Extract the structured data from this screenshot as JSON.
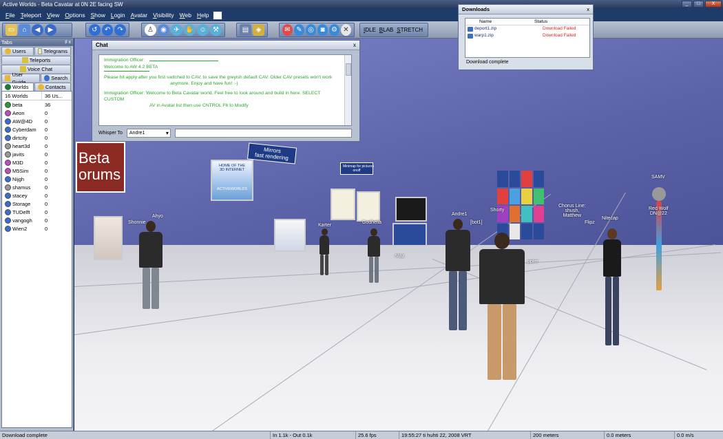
{
  "window": {
    "title": "Active Worlds - Beta Cavatar at 0N 2E facing SW",
    "min": "_",
    "max": "□",
    "close": "X"
  },
  "menu": [
    "File",
    "Teleport",
    "View",
    "Options",
    "Show",
    "Login",
    "Avatar",
    "Visibility",
    "Web",
    "Help"
  ],
  "toolbar": {
    "gestures": [
      "IDLE",
      "BLAB",
      "STRETCH"
    ]
  },
  "tabs_panel": {
    "title": "Tabs",
    "pin": "♯ x",
    "tabs": [
      "Users",
      "Telegrams",
      "Teleports",
      "Voice Chat",
      "User Guide",
      "Search",
      "Worlds",
      "Contacts"
    ],
    "worlds_header": {
      "count": "16 Worlds",
      "users": "36 Us..."
    },
    "worlds": [
      {
        "name": "beta",
        "users": "36",
        "color": "#2a9b3a"
      },
      {
        "name": "Aeon",
        "users": "0",
        "color": "#c04bc0"
      },
      {
        "name": "AW@4D",
        "users": "0",
        "color": "#3a6fd0"
      },
      {
        "name": "Cyberdam",
        "users": "0",
        "color": "#3a6fd0"
      },
      {
        "name": "dirtcity",
        "users": "0",
        "color": "#3a6fd0"
      },
      {
        "name": "heart3d",
        "users": "0",
        "color": "#9a9a9a"
      },
      {
        "name": "javits",
        "users": "0",
        "color": "#9a9a9a"
      },
      {
        "name": "M3D",
        "users": "0",
        "color": "#c04bc0"
      },
      {
        "name": "M5Sim",
        "users": "0",
        "color": "#c04bc0"
      },
      {
        "name": "Nijgh",
        "users": "0",
        "color": "#3a6fd0"
      },
      {
        "name": "shamus",
        "users": "0",
        "color": "#9a9a9a"
      },
      {
        "name": "stacey",
        "users": "0",
        "color": "#3a6fd0"
      },
      {
        "name": "Storage",
        "users": "0",
        "color": "#3a6fd0"
      },
      {
        "name": "TUDelft",
        "users": "0",
        "color": "#3a6fd0"
      },
      {
        "name": "vangogh",
        "users": "0",
        "color": "#3a6fd0"
      },
      {
        "name": "Wien2",
        "users": "0",
        "color": "#3a6fd0"
      }
    ]
  },
  "chat": {
    "title": "Chat",
    "close": "x",
    "lines": [
      "Immigration Officer:",
      "Welcome to AW 4.2 BETA",
      "Please hit apply after you first switched to CAV, to save the greyish default CAV. Older CAV presets won't work",
      "anymore. Enjoy and have fun! :-)",
      "Immigration Officer:      Welcome to Beta Cavatar world. Feel free to look around and build in here. SELECT CUSTOM",
      "AV in Avatar list then use CNTROL F6 to Modify"
    ],
    "whisper_label": "Whisper To",
    "whisper_target": "Andre1"
  },
  "downloads": {
    "title": "Downloads",
    "close": "x",
    "columns": [
      "Name",
      "Status"
    ],
    "rows": [
      {
        "name": "deport1.zip",
        "status": "Download Failed"
      },
      {
        "name": "warp1.zip",
        "status": "Download Failed"
      }
    ],
    "status": "Download complete"
  },
  "scene": {
    "signs": {
      "forums": "Beta\norums",
      "mirrors": "Mirrors\nfast rendering",
      "minimap": "Minimap for pictures\nonoff",
      "home_title": "HOME OF THE\n3D INTERNET",
      "home_brand": "ACTIVEWORLDS"
    },
    "labels": [
      "Shonnie",
      "Ahyo",
      "Karter",
      "Godhelia",
      "Andre1",
      "[bot1]",
      "Shorty",
      "Chorus Line:\nshush,\nMatthew",
      "Flipz",
      "Nitecap",
      "SAMV",
      "Red Wolf\nDN@22",
      "Maz",
      "ppler"
    ]
  },
  "statusbar": {
    "message": "Download complete",
    "traffic": "In 1.1k - Out 0.1k",
    "fps": "25.6 fps",
    "datetime": "19:55:27 ti huhti 22, 2008 VRT",
    "visibility": "200 meters",
    "altitude": "0.0 meters",
    "speed": "0.0 m/s"
  }
}
